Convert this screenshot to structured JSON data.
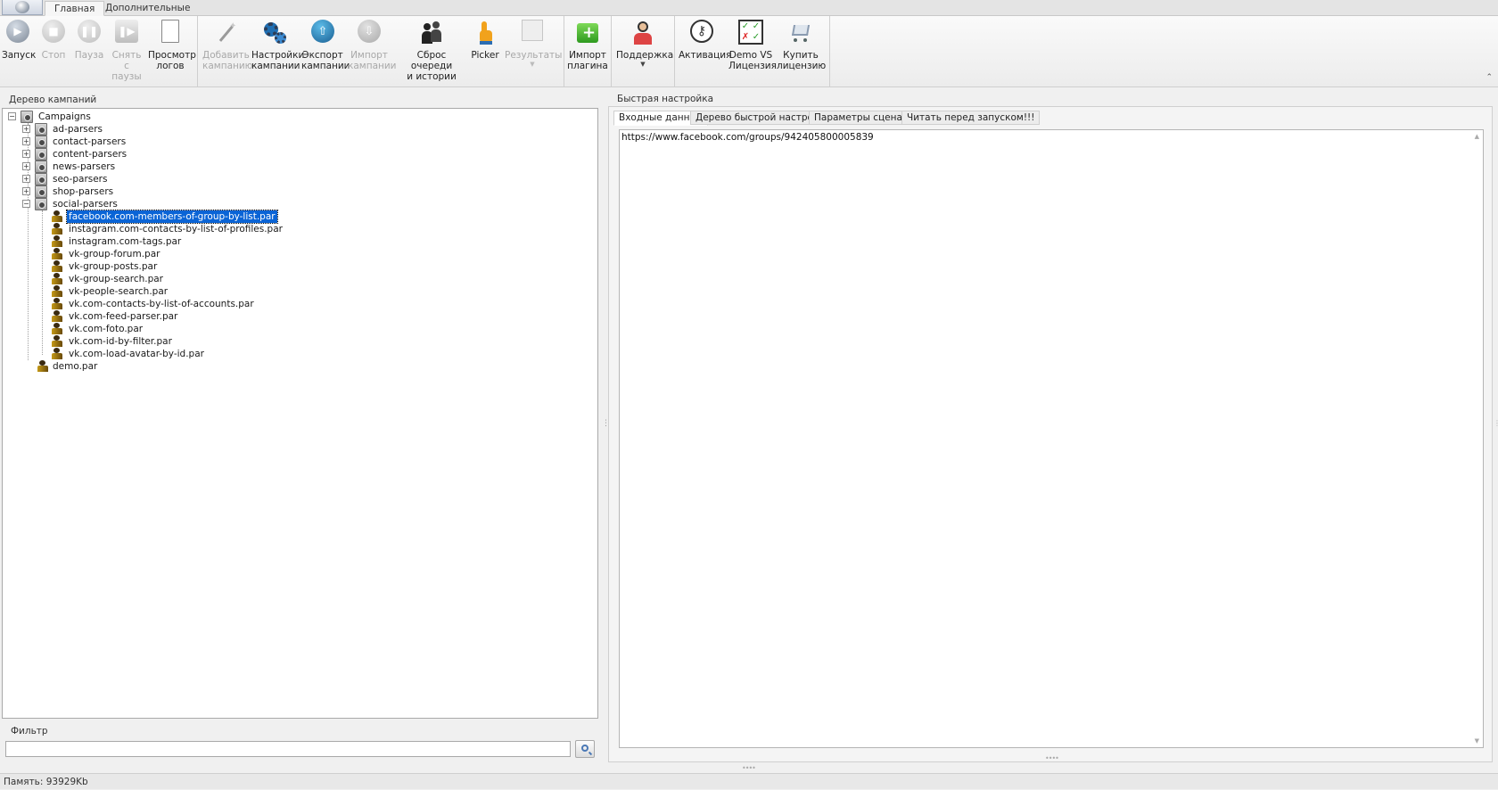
{
  "tabs": [
    "Главная",
    "Дополнительные"
  ],
  "ribbon": {
    "buttons": [
      {
        "id": "start",
        "label": "Запуск",
        "icon": "play-icon",
        "disabled": false
      },
      {
        "id": "stop",
        "label": "Стоп",
        "icon": "stop-icon",
        "disabled": true
      },
      {
        "id": "pause",
        "label": "Пауза",
        "icon": "pause-icon",
        "disabled": true
      },
      {
        "id": "unpause",
        "label": "Снять с\nпаузы",
        "icon": "resume-icon",
        "disabled": true
      },
      {
        "id": "logs",
        "label": "Просмотр\nлогов",
        "icon": "log-document-icon",
        "disabled": false
      },
      {
        "id": "add",
        "label": "Добавить\nкампанию",
        "icon": "magic-wand-icon",
        "disabled": true
      },
      {
        "id": "settings",
        "label": "Настройки\nкампании",
        "icon": "gears-icon",
        "disabled": false
      },
      {
        "id": "export",
        "label": "Экспорт\nкампании",
        "icon": "upload-arrow-icon",
        "disabled": false
      },
      {
        "id": "import",
        "label": "Импорт\nкампании",
        "icon": "download-arrow-icon",
        "disabled": true
      },
      {
        "id": "reset",
        "label": "Сброс очереди\nи истории",
        "icon": "people-reset-icon",
        "disabled": false
      },
      {
        "id": "picker",
        "label": "Picker",
        "icon": "pointer-hand-icon",
        "disabled": false
      },
      {
        "id": "results",
        "label": "Результаты",
        "icon": "results-grid-icon",
        "disabled": true
      },
      {
        "id": "import-plugin",
        "label": "Импорт\nплагина",
        "icon": "puzzle-plus-icon",
        "disabled": false
      },
      {
        "id": "support",
        "label": "Поддержка",
        "icon": "support-person-icon",
        "disabled": false
      },
      {
        "id": "activation",
        "label": "Активация",
        "icon": "key-icon",
        "disabled": false
      },
      {
        "id": "demo-vs",
        "label": "Demo VS\nЛицензия",
        "icon": "checklist-icon",
        "disabled": false
      },
      {
        "id": "buy",
        "label": "Купить\nлицензию",
        "icon": "cart-icon",
        "disabled": false
      }
    ]
  },
  "left_panel": {
    "title": "Дерево кампаний",
    "tree": {
      "root": "Campaigns",
      "folders": [
        "ad-parsers",
        "contact-parsers",
        "content-parsers",
        "news-parsers",
        "seo-parsers",
        "shop-parsers",
        "social-parsers"
      ],
      "social_children": [
        "facebook.com-members-of-group-by-list.par",
        "instagram.com-contacts-by-list-of-profiles.par",
        "instagram.com-tags.par",
        "vk-group-forum.par",
        "vk-group-posts.par",
        "vk-group-search.par",
        "vk-people-search.par",
        "vk.com-contacts-by-list-of-accounts.par",
        "vk.com-feed-parser.par",
        "vk.com-foto.par",
        "vk.com-id-by-filter.par",
        "vk.com-load-avatar-by-id.par"
      ],
      "selected": "facebook.com-members-of-group-by-list.par",
      "root_file": "demo.par"
    },
    "filter": {
      "label": "Фильтр",
      "value": ""
    }
  },
  "right_panel": {
    "title": "Быстрая настройка",
    "tabs": [
      "Входные данные",
      "Дерево быстрой настройки",
      "Параметры сценария",
      "Читать перед запуском!!!"
    ],
    "input_text": "https://www.facebook.com/groups/942405800005839"
  },
  "status": {
    "memory": "Память: 93929Kb"
  },
  "colors": {
    "selection": "#0a64d6",
    "ribbon_bg": "#f4f4f4"
  }
}
